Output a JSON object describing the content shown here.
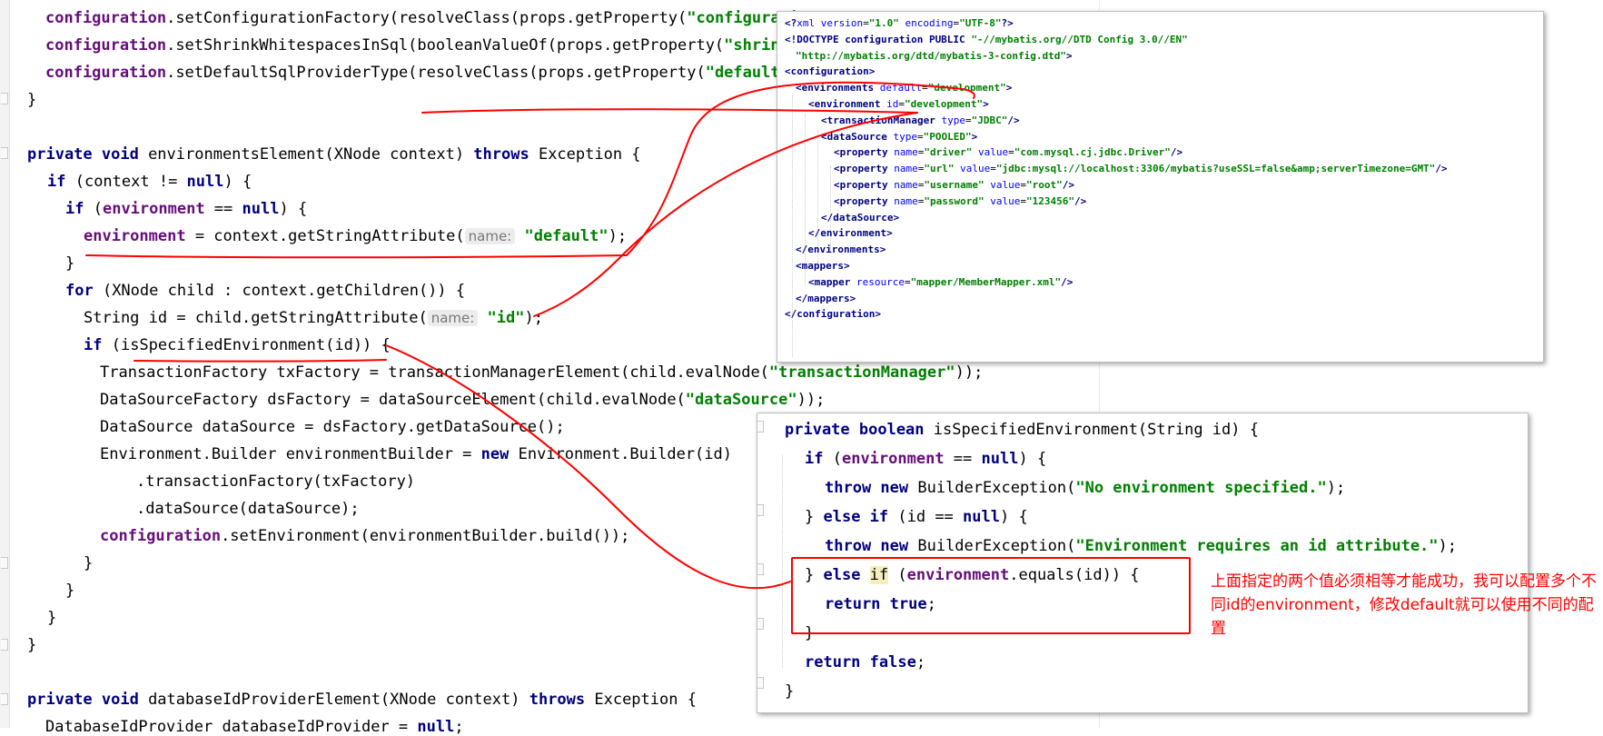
{
  "editor": {
    "lines": [
      [
        [
          "fld",
          "configuration"
        ],
        [
          "",
          "."
        ],
        [
          "",
          "setConfigurationFactory(resolveClass(props.getProperty("
        ],
        [
          "str",
          "\"configurati"
        ]
      ],
      [
        [
          "fld",
          "configuration"
        ],
        [
          "",
          "."
        ],
        [
          "",
          "setShrinkWhitespacesInSql(booleanValueOf(props.getProperty("
        ],
        [
          "str",
          "\"shrinkW"
        ]
      ],
      [
        [
          "fld",
          "configuration"
        ],
        [
          "",
          "."
        ],
        [
          "",
          "setDefaultSqlProviderType(resolveClass(props.getProperty("
        ],
        [
          "str",
          "\"defaultSq"
        ]
      ],
      [
        [
          "",
          "}"
        ]
      ],
      [],
      [
        [
          "kw",
          "private void "
        ],
        [
          "",
          "environmentsElement(XNode context) "
        ],
        [
          "kw",
          "throws "
        ],
        [
          "",
          "Exception {"
        ]
      ],
      [
        [
          "kw",
          "if "
        ],
        [
          "",
          "(context != "
        ],
        [
          "kw",
          "null"
        ],
        [
          "",
          ") {"
        ]
      ],
      [
        [
          "kw",
          "if "
        ],
        [
          "",
          "("
        ],
        [
          "fld",
          "environment "
        ],
        [
          "",
          "== "
        ],
        [
          "kw",
          "null"
        ],
        [
          "",
          ") {"
        ]
      ],
      [
        [
          "fld",
          "environment "
        ],
        [
          "",
          "= context.getStringAttribute("
        ],
        [
          "hint",
          "name:"
        ],
        [
          "str",
          " \"default\""
        ],
        [
          "",
          ");"
        ]
      ],
      [
        [
          "",
          "}"
        ]
      ],
      [
        [
          "kw",
          "for "
        ],
        [
          "",
          "(XNode child : context.getChildren()) {"
        ]
      ],
      [
        [
          "",
          "String id = child.getStringAttribute("
        ],
        [
          "hint",
          "name:"
        ],
        [
          "str",
          " \"id\""
        ],
        [
          "",
          ");"
        ]
      ],
      [
        [
          "kw",
          "if "
        ],
        [
          "",
          "(isSpecifiedEnvironment(id)) {"
        ]
      ],
      [
        [
          "",
          "TransactionFactory txFactory = transactionManagerElement(child.evalNode("
        ],
        [
          "str",
          "\"transactionManager\""
        ],
        [
          "",
          "));"
        ]
      ],
      [
        [
          "",
          "DataSourceFactory dsFactory = dataSourceElement(child.evalNode("
        ],
        [
          "str",
          "\"dataSource\""
        ],
        [
          "",
          "));"
        ]
      ],
      [
        [
          "",
          "DataSource dataSource = dsFactory.getDataSource();"
        ]
      ],
      [
        [
          "",
          "Environment.Builder environmentBuilder = "
        ],
        [
          "kw",
          "new "
        ],
        [
          "",
          "Environment.Builder(id)"
        ]
      ],
      [
        [
          "",
          ".transactionFactory(txFactory)"
        ]
      ],
      [
        [
          "",
          ".dataSource(dataSource);"
        ]
      ],
      [
        [
          "fld",
          "configuration"
        ],
        [
          "",
          ".setEnvironment(environmentBuilder.build());"
        ]
      ],
      [
        [
          "",
          "}"
        ]
      ],
      [
        [
          "",
          "}"
        ]
      ],
      [
        [
          "",
          "}"
        ]
      ],
      [
        [
          "",
          "}"
        ]
      ],
      [],
      [
        [
          "kw",
          "private void "
        ],
        [
          "",
          "databaseIdProviderElement(XNode context) "
        ],
        [
          "kw",
          "throws "
        ],
        [
          "",
          "Exception {"
        ]
      ],
      [
        [
          "",
          "DatabaseIdProvider databaseIdProvider = "
        ],
        [
          "kw",
          "null"
        ],
        [
          "",
          ";"
        ]
      ]
    ]
  },
  "xml_config": {
    "lines": [
      [
        [
          "tg",
          "<?"
        ],
        [
          "at",
          "xml version"
        ],
        [
          "",
          "="
        ],
        [
          "av",
          "\"1.0\""
        ],
        [
          "at",
          " encoding"
        ],
        [
          "",
          "="
        ],
        [
          "av",
          "\"UTF-8\""
        ],
        [
          "tg",
          "?>"
        ]
      ],
      [
        [
          "tg",
          "<!DOCTYPE configuration PUBLIC "
        ],
        [
          "av",
          "\"-//mybatis.org//DTD Config 3.0//EN\""
        ]
      ],
      [
        [
          "av",
          "\"http://mybatis.org/dtd/mybatis-3-config.dtd\""
        ],
        [
          "tg",
          ">"
        ]
      ],
      [
        [
          "tg",
          "<configuration>"
        ]
      ],
      [
        [
          "tg",
          "<environments "
        ],
        [
          "at",
          "default"
        ],
        [
          "",
          "="
        ],
        [
          "av",
          "\"development\""
        ],
        [
          "tg",
          ">"
        ]
      ],
      [
        [
          "tg",
          "<environment "
        ],
        [
          "at",
          "id"
        ],
        [
          "",
          "="
        ],
        [
          "av",
          "\"development\""
        ],
        [
          "tg",
          ">"
        ]
      ],
      [
        [
          "tg",
          "<transactionManager "
        ],
        [
          "at",
          "type"
        ],
        [
          "",
          "="
        ],
        [
          "av",
          "\"JDBC\""
        ],
        [
          "tg",
          "/>"
        ]
      ],
      [
        [
          "tg",
          "<dataSource "
        ],
        [
          "at",
          "type"
        ],
        [
          "",
          "="
        ],
        [
          "av",
          "\"POOLED\""
        ],
        [
          "tg",
          ">"
        ]
      ],
      [
        [
          "tg",
          "<property "
        ],
        [
          "at",
          "name"
        ],
        [
          "",
          "="
        ],
        [
          "av",
          "\"driver\""
        ],
        [
          "at",
          " value"
        ],
        [
          "",
          "="
        ],
        [
          "av",
          "\"com.mysql.cj.jdbc.Driver\""
        ],
        [
          "tg",
          "/>"
        ]
      ],
      [
        [
          "tg",
          "<property "
        ],
        [
          "at",
          "name"
        ],
        [
          "",
          "="
        ],
        [
          "av",
          "\"url\""
        ],
        [
          "at",
          " value"
        ],
        [
          "",
          "="
        ],
        [
          "av",
          "\"jdbc:mysql://localhost:3306/mybatis?useSSL=false&amp;serverTimezone=GMT\""
        ],
        [
          "tg",
          "/>"
        ]
      ],
      [
        [
          "tg",
          "<property "
        ],
        [
          "at",
          "name"
        ],
        [
          "",
          "="
        ],
        [
          "av",
          "\"username\""
        ],
        [
          "at",
          " value"
        ],
        [
          "",
          "="
        ],
        [
          "av",
          "\"root\""
        ],
        [
          "tg",
          "/>"
        ]
      ],
      [
        [
          "tg",
          "<property "
        ],
        [
          "at",
          "name"
        ],
        [
          "",
          "="
        ],
        [
          "av",
          "\"password\""
        ],
        [
          "at",
          " value"
        ],
        [
          "",
          "="
        ],
        [
          "av",
          "\"123456\""
        ],
        [
          "tg",
          "/>"
        ]
      ],
      [
        [
          "tg",
          "</dataSource>"
        ]
      ],
      [
        [
          "tg",
          "</environment>"
        ]
      ],
      [
        [
          "tg",
          "</environments>"
        ]
      ],
      [
        [
          "tg",
          "<mappers>"
        ]
      ],
      [
        [
          "tg",
          "<mapper "
        ],
        [
          "at",
          "resource"
        ],
        [
          "",
          "="
        ],
        [
          "av",
          "\"mapper/MemberMapper.xml\""
        ],
        [
          "tg",
          "/>"
        ]
      ],
      [
        [
          "tg",
          "</mappers>"
        ]
      ],
      [
        [
          "tg",
          "</configuration>"
        ]
      ]
    ]
  },
  "method_popup": {
    "lines": [
      [
        [
          "kw",
          "private boolean "
        ],
        [
          "",
          "isSpecifiedEnvironment(String id) {"
        ]
      ],
      [
        [
          "kw",
          "if "
        ],
        [
          "",
          "("
        ],
        [
          "fld",
          "environment "
        ],
        [
          "",
          "== "
        ],
        [
          "kw",
          "null"
        ],
        [
          "",
          ") {"
        ]
      ],
      [
        [
          "kw",
          "throw new "
        ],
        [
          "",
          "BuilderException("
        ],
        [
          "str",
          "\"No environment specified.\""
        ],
        [
          "",
          ");"
        ]
      ],
      [
        [
          "",
          "} "
        ],
        [
          "kw",
          "else if "
        ],
        [
          "",
          "(id == "
        ],
        [
          "kw",
          "null"
        ],
        [
          "",
          ") {"
        ]
      ],
      [
        [
          "kw",
          "throw new "
        ],
        [
          "",
          "BuilderException("
        ],
        [
          "str",
          "\"Environment requires an id attribute.\""
        ],
        [
          "",
          ");"
        ]
      ],
      [
        [
          "",
          "} "
        ],
        [
          "kw",
          "else "
        ],
        [
          "hl",
          "if"
        ],
        [
          "",
          " ("
        ],
        [
          "fld",
          "environment"
        ],
        [
          "",
          ".equals(id)) {"
        ]
      ],
      [
        [
          "kw",
          "return true"
        ],
        [
          "",
          ";"
        ]
      ],
      [
        [
          "",
          "}"
        ]
      ],
      [
        [
          "kw",
          "return false"
        ],
        [
          "",
          ";"
        ]
      ],
      [
        [
          "",
          "}"
        ]
      ]
    ]
  },
  "annotation": {
    "note": "上面指定的两个值必须相等才能成功，我可以配置多个不同id的environment，修改default就可以使用不同的配置",
    "color": "#ff0000"
  }
}
